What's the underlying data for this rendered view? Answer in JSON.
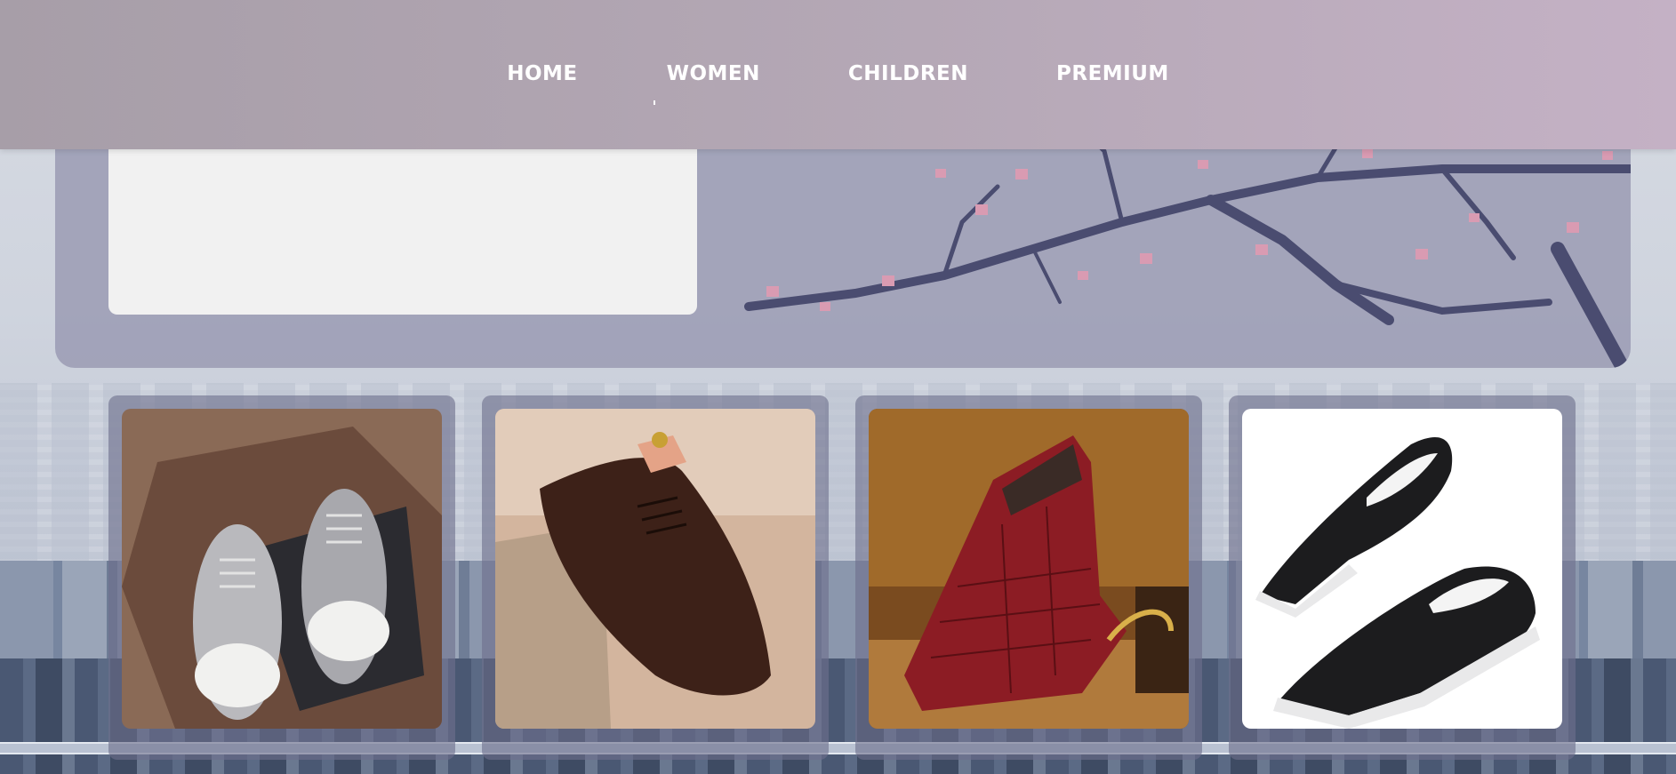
{
  "nav": {
    "items": [
      {
        "label": "HOME"
      },
      {
        "label": "WOMEN"
      },
      {
        "label": "CHILDREN"
      },
      {
        "label": "PREMIUM"
      }
    ]
  },
  "hero": {
    "card_text": ""
  },
  "products": [
    {
      "icon": "grey-sneakers-image"
    },
    {
      "icon": "brown-suede-oxford-image"
    },
    {
      "icon": "red-croc-chelsea-boot-image"
    },
    {
      "icon": "black-slip-on-sneakers-image"
    }
  ],
  "colors": {
    "nav_start": "#a79ea8",
    "nav_end": "#c4b1c5",
    "nav_text": "#ffffff",
    "hero_panel": "#9696af",
    "card_frame": "#6e708c"
  }
}
